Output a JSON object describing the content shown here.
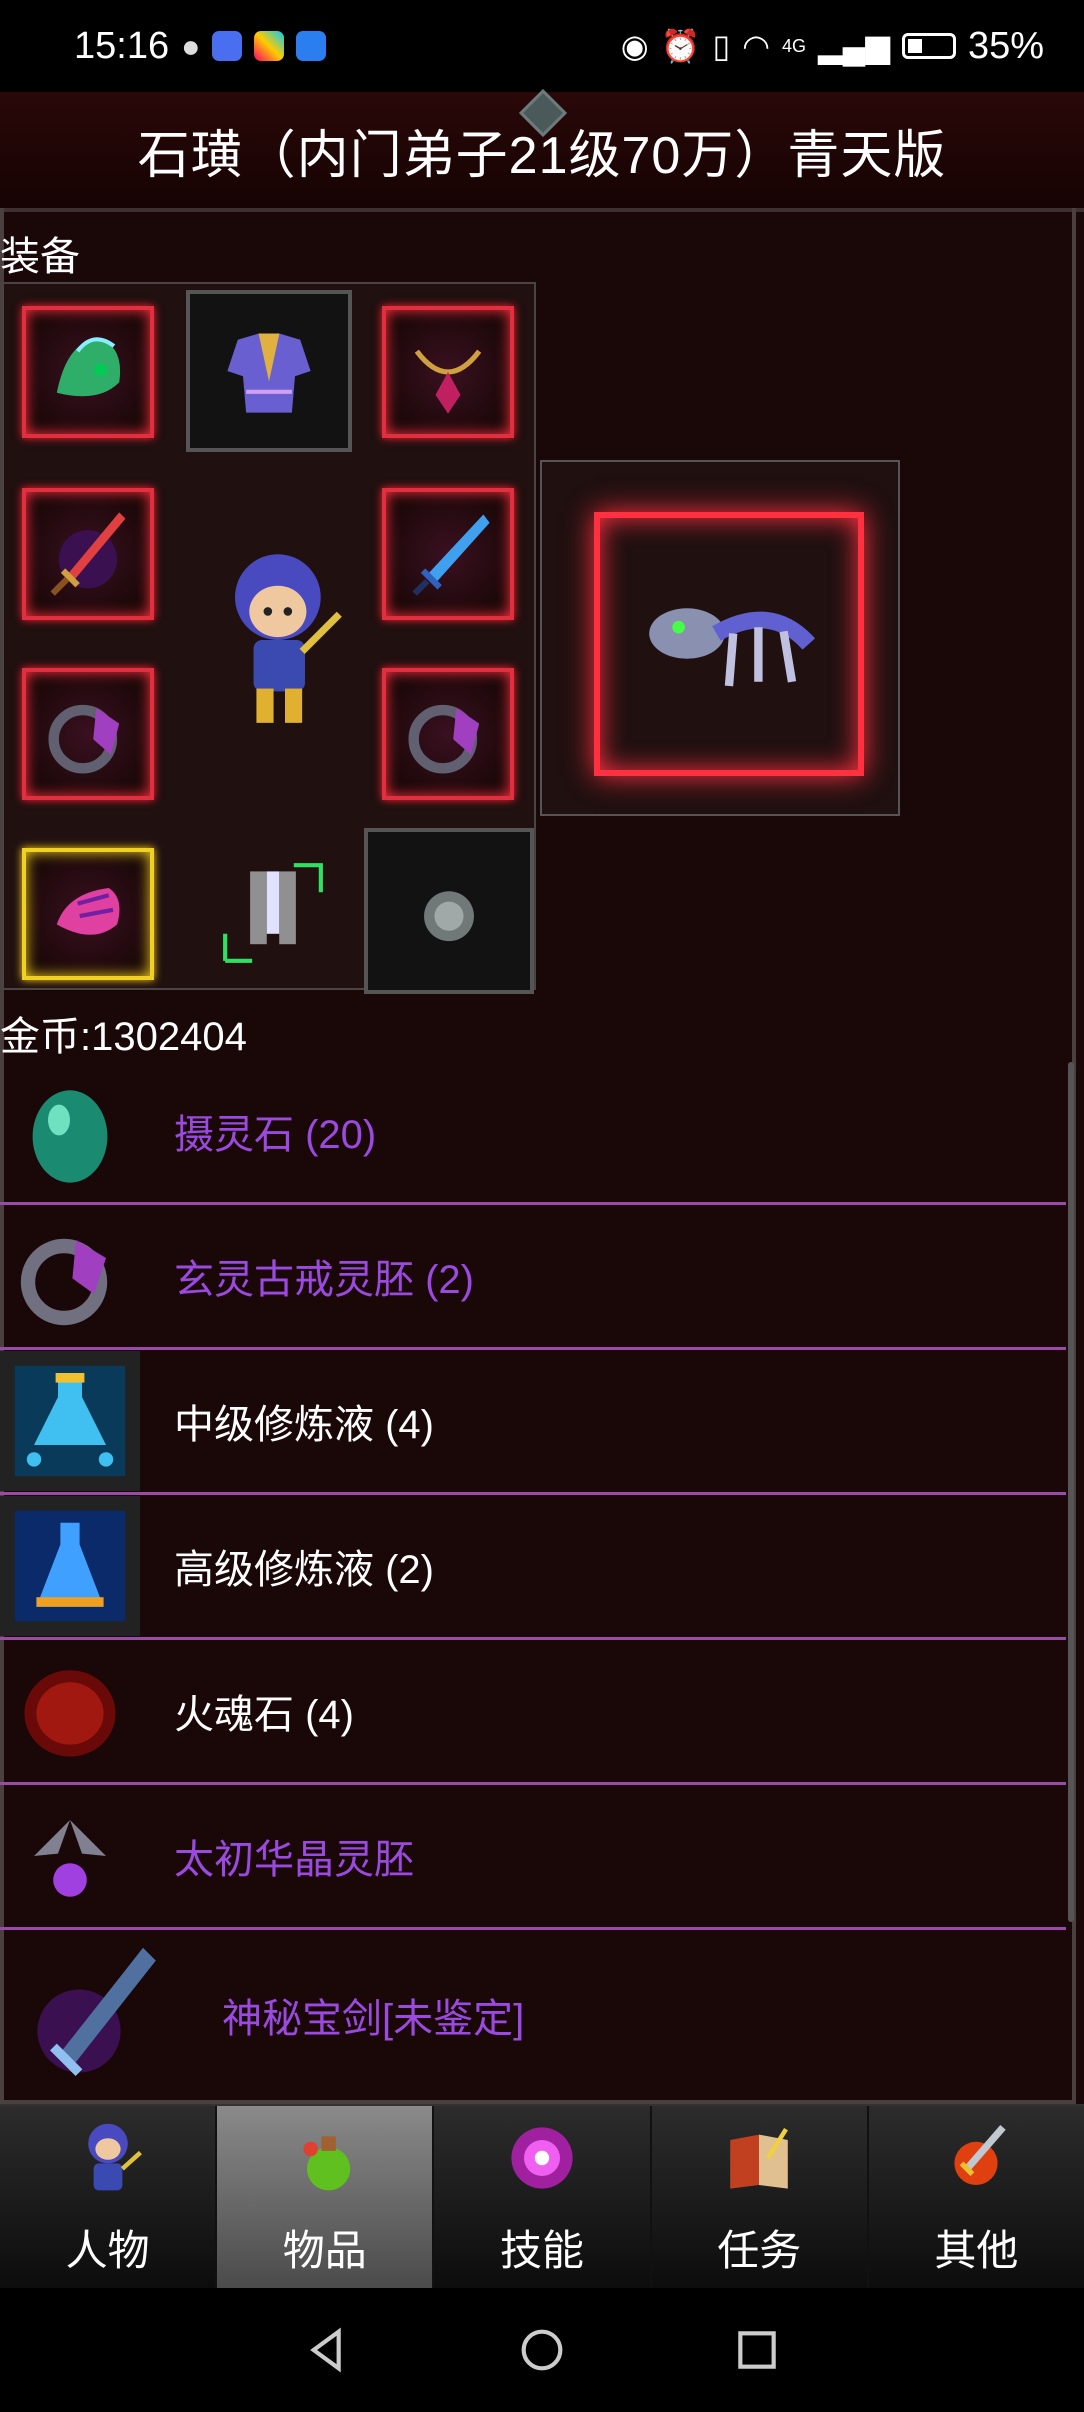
{
  "status_bar": {
    "time": "15:16",
    "battery_percent": "35%",
    "network_label": "4G"
  },
  "title": "石璜（内门弟子21级70万）青天版",
  "equipment": {
    "section_label": "装备"
  },
  "gold": {
    "label": "金币:1302404"
  },
  "inventory": {
    "items": [
      {
        "name": "摄灵石 (20)",
        "color": "purple",
        "icon": "teal-egg-stone-icon"
      },
      {
        "name": "玄灵古戒灵胚 (2)",
        "color": "purple",
        "icon": "ring-icon"
      },
      {
        "name": "中级修炼液 (4)",
        "color": "white",
        "icon": "potion-flask-icon"
      },
      {
        "name": "高级修炼液 (2)",
        "color": "white",
        "icon": "blue-potion-icon"
      },
      {
        "name": "火魂石 (4)",
        "color": "white",
        "icon": "red-fire-stone-icon"
      },
      {
        "name": "太初华晶灵胚",
        "color": "purple",
        "icon": "winged-crystal-icon"
      },
      {
        "name": "神秘宝剑[未鉴定]",
        "color": "purple",
        "icon": "sword-icon"
      }
    ]
  },
  "tabs": [
    {
      "label": "人物",
      "icon": "character-icon",
      "active": false
    },
    {
      "label": "物品",
      "icon": "items-potion-icon",
      "active": true
    },
    {
      "label": "技能",
      "icon": "skill-swirl-icon",
      "active": false
    },
    {
      "label": "任务",
      "icon": "quest-book-icon",
      "active": false
    },
    {
      "label": "其他",
      "icon": "other-sword-icon",
      "active": false
    }
  ],
  "colors": {
    "background": "#1a0707",
    "item_purple": "#9a4ae0",
    "row_divider": "#9a4aa8",
    "slot_red_glow": "#ff3040",
    "slot_gold_glow": "#f0d020"
  }
}
